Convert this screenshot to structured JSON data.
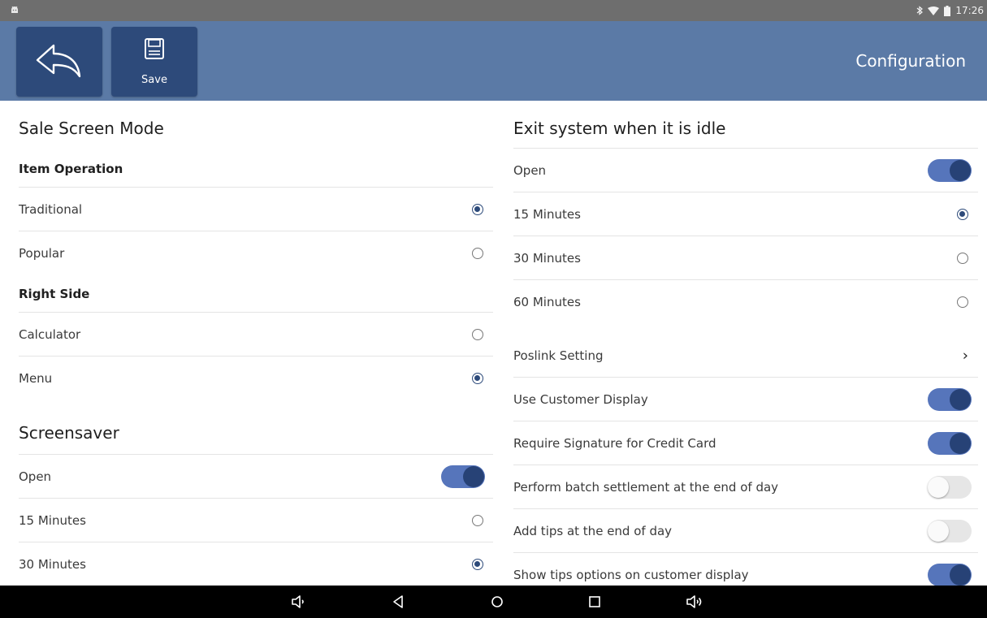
{
  "status_bar": {
    "time": "17:26",
    "icons": [
      "android-icon",
      "bluetooth-icon",
      "wifi-icon",
      "battery-icon"
    ]
  },
  "header": {
    "title": "Configuration",
    "back_icon": "back-arrow-icon",
    "save_label": "Save",
    "save_icon": "floppy-disk-icon",
    "colors": {
      "bar": "#5b7aa6",
      "button": "#2d4a7a"
    }
  },
  "left": {
    "sale_screen_mode": {
      "title": "Sale Screen Mode",
      "item_operation": {
        "title": "Item Operation",
        "options": [
          {
            "label": "Traditional",
            "selected": true
          },
          {
            "label": "Popular",
            "selected": false
          }
        ]
      },
      "right_side": {
        "title": "Right Side",
        "options": [
          {
            "label": "Calculator",
            "selected": false
          },
          {
            "label": "Menu",
            "selected": true
          }
        ]
      }
    },
    "screensaver": {
      "title": "Screensaver",
      "open": {
        "label": "Open",
        "on": true
      },
      "options": [
        {
          "label": "15 Minutes",
          "selected": false
        },
        {
          "label": "30 Minutes",
          "selected": true
        }
      ]
    }
  },
  "right": {
    "exit_idle": {
      "title": "Exit system when it is idle",
      "open": {
        "label": "Open",
        "on": true
      },
      "options": [
        {
          "label": "15 Minutes",
          "selected": true
        },
        {
          "label": "30 Minutes",
          "selected": false
        },
        {
          "label": "60 Minutes",
          "selected": false
        }
      ]
    },
    "poslink": {
      "label": "Poslink Setting",
      "icon": "chevron-right-icon"
    },
    "toggles": [
      {
        "label": "Use Customer Display",
        "on": true
      },
      {
        "label": "Require Signature for Credit Card",
        "on": true
      },
      {
        "label": "Perform batch settlement at the end of day",
        "on": false
      },
      {
        "label": "Add tips at the end of day",
        "on": false
      },
      {
        "label": "Show tips options on customer display",
        "on": true
      }
    ]
  },
  "nav_bar": {
    "icons": [
      "volume-down-icon",
      "back-triangle-icon",
      "home-circle-icon",
      "recents-square-icon",
      "volume-up-icon"
    ]
  }
}
